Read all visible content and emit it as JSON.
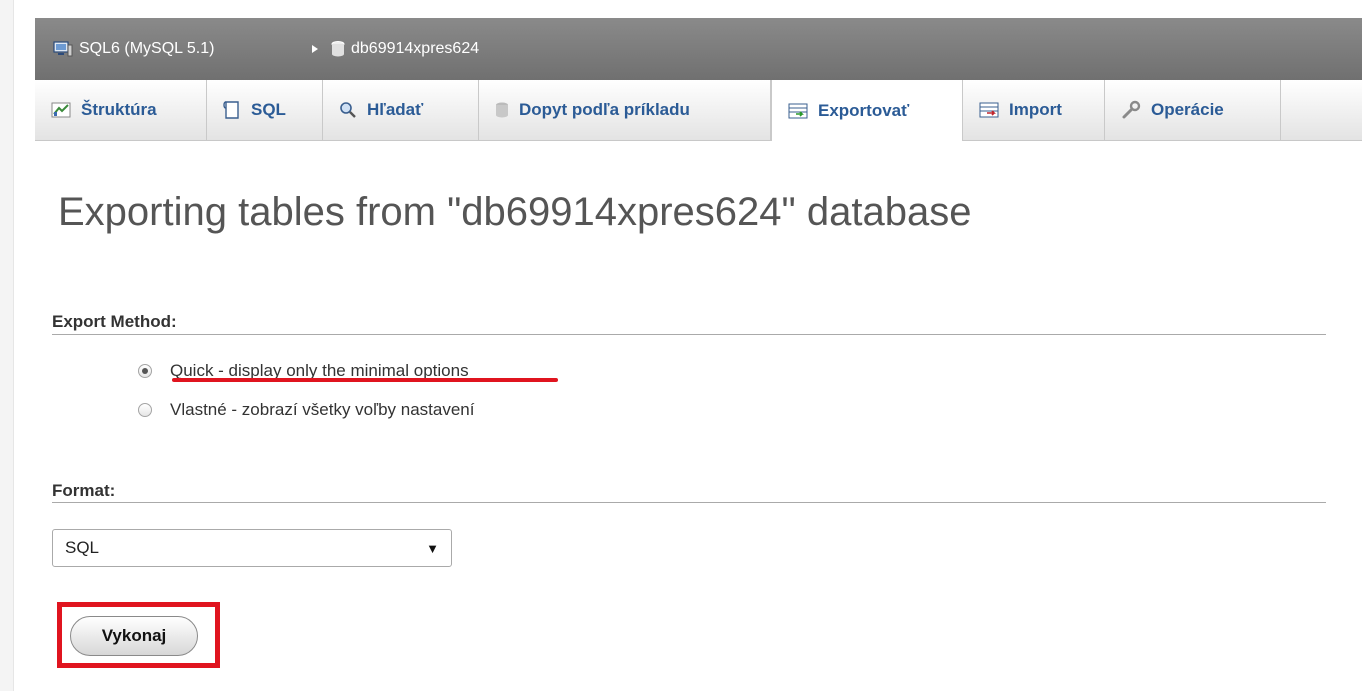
{
  "breadcrumb": {
    "server": "SQL6 (MySQL 5.1)",
    "database": "db69914xpres624"
  },
  "tabs": [
    {
      "label": "Štruktúra",
      "icon": "structure-icon"
    },
    {
      "label": "SQL",
      "icon": "sql-icon"
    },
    {
      "label": "Hľadať",
      "icon": "search-icon"
    },
    {
      "label": "Dopyt podľa príkladu",
      "icon": "query-icon"
    },
    {
      "label": "Exportovať",
      "icon": "export-icon",
      "active": true
    },
    {
      "label": "Import",
      "icon": "import-icon"
    },
    {
      "label": "Operácie",
      "icon": "wrench-icon"
    }
  ],
  "page_title": "Exporting tables from \"db69914xpres624\" database",
  "export_method": {
    "label": "Export Method:",
    "options": [
      {
        "label": "Quick - display only the minimal options",
        "checked": true
      },
      {
        "label": "Vlastné - zobrazí všetky voľby nastavení",
        "checked": false
      }
    ]
  },
  "format": {
    "label": "Format:",
    "selected": "SQL"
  },
  "submit_label": "Vykonaj",
  "colors": {
    "accent": "#2b5b96",
    "annotation": "#e0141f",
    "topbar": "#7b7b7b"
  }
}
